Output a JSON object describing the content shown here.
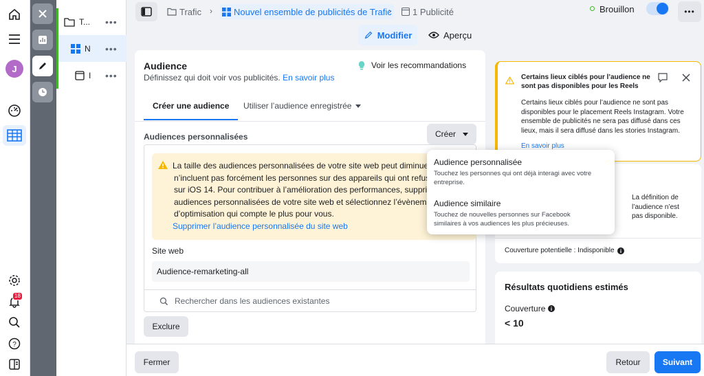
{
  "rail": {
    "avatar_initial": "J",
    "notification_count": "18"
  },
  "tree": {
    "campaign_label": "T...",
    "adset_label": "N",
    "ad_label": "I"
  },
  "topbar": {
    "crumb_campaign": "Trafic",
    "crumb_adset": "Nouvel ensemble de publicités de Trafic",
    "crumb_ads": "1 Publicité",
    "status": "Brouillon",
    "edit_label": "Modifier",
    "preview_label": "Aperçu"
  },
  "audience": {
    "title": "Audience",
    "subtitle": "Définissez qui doit voir vos publicités.",
    "learn_more": "En savoir plus",
    "recommendations": "Voir les recommandations",
    "tab_create": "Créer une audience",
    "tab_saved": "Utiliser l’audience enregistrée",
    "custom_heading": "Audiences personnalisées",
    "create_button": "Créer",
    "warning_text_1": "La taille des audiences personnalisées de votre site web peut diminuer",
    "warning_text_2": "n’incluent pas forcément les personnes sur des appareils qui ont refusé",
    "warning_text_3": "sur iOS 14. Pour contribuer à l’amélioration des performances, supprim",
    "warning_text_4": "audiences personnalisées de votre site web et sélectionnez l’évènem",
    "warning_text_5": "d’optimisation qui compte le plus pour vous.",
    "warning_link": "Supprimer l’audience personnalisée du site web",
    "site_label": "Site web",
    "site_value": "Audience-remarketing-all",
    "search_placeholder": "Rechercher dans les audiences existantes",
    "exclude_button": "Exclure"
  },
  "dropdown": {
    "items": [
      {
        "title": "Audience personnalisée",
        "desc_1": "Touchez les personnes qui ont déjà interagi avec votre",
        "desc_2": "entreprise."
      },
      {
        "title": "Audience similaire",
        "desc_1": "Touchez de nouvelles personnes sur Facebook",
        "desc_2": "similaires à vos audiences les plus précieuses."
      }
    ]
  },
  "notice": {
    "title_1": "Certains lieux ciblés pour l’audience ne",
    "title_2": "sont pas disponibles pour les Reels",
    "body_1": "Certains lieux ciblés pour l’audience ne sont pas",
    "body_2": "disponibles pour le placement Reels Instagram. Votre",
    "body_3": "ensemble de publicités ne sera pas diffusé dans ces",
    "body_4": "lieux, mais il sera diffusé dans les stories Instagram.",
    "link": "En savoir plus"
  },
  "definition": {
    "text_1": "La définition de",
    "text_2": "l’audience n’est",
    "text_3": "pas disponible.",
    "coverage_label": "Couverture potentielle : Indisponible"
  },
  "results": {
    "title": "Résultats quotidiens estimés",
    "coverage_label": "Couverture",
    "coverage_value": "< 10"
  },
  "footer": {
    "close": "Fermer",
    "back": "Retour",
    "next": "Suivant"
  },
  "colors": {
    "accent": "#1877f2",
    "warning_bg": "#fef3d6",
    "warning_icon": "#f5b800",
    "status_green": "#42b72a"
  }
}
